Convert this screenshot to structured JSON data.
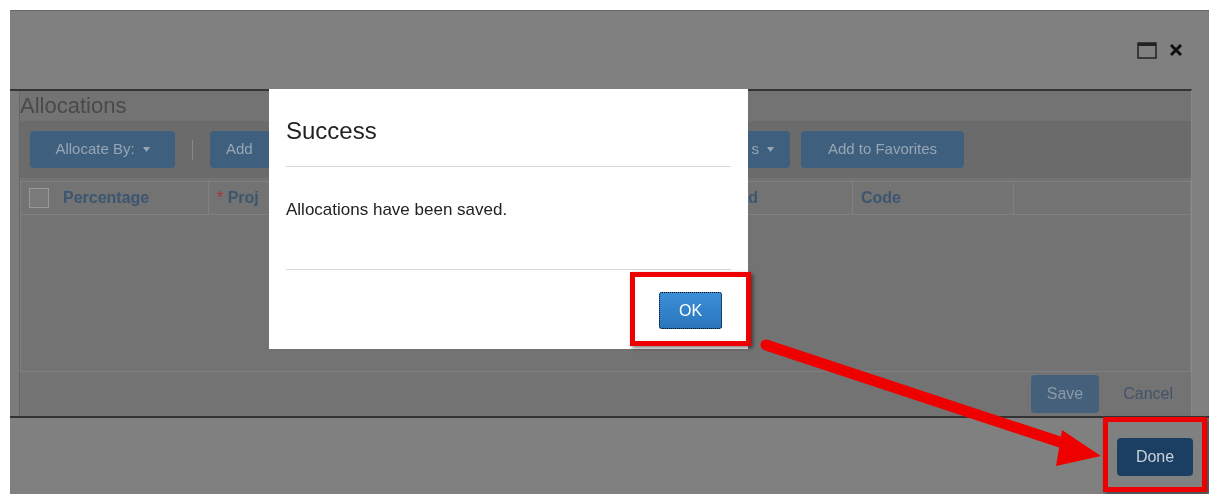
{
  "window": {
    "title": "Allocations"
  },
  "toolbar": [
    {
      "kind": "dropdown",
      "label": "Allocate By:"
    },
    {
      "kind": "separator"
    },
    {
      "kind": "button",
      "label": "Add"
    },
    {
      "kind": "dropdown",
      "label": "s"
    },
    {
      "kind": "button",
      "label": "Add to Favorites"
    }
  ],
  "table": {
    "columns": [
      {
        "label": "Percentage",
        "checked": false
      },
      {
        "mark": "*",
        "label": "Proj"
      },
      {
        "label": "d"
      },
      {
        "label": "Code"
      }
    ]
  },
  "footer_buttons": [
    {
      "kind": "primary",
      "label": "Save"
    },
    {
      "kind": "link",
      "label": "Cancel"
    }
  ],
  "done_button": {
    "label": "Done"
  },
  "dialog": {
    "title": "Success",
    "message": "Allocations have been saved.",
    "button": "OK",
    "focused": true
  }
}
